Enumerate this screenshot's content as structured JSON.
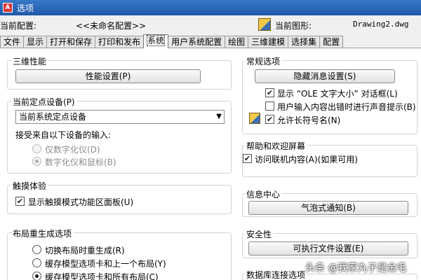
{
  "window": {
    "title": "选项",
    "icon": "app-icon"
  },
  "header": {
    "config_label": "当前配置:",
    "config_value": "<<未命名配置>>",
    "drawing_label": "当前图形:",
    "drawing_value": "Drawing2.dwg"
  },
  "tabs": [
    {
      "label": "文件"
    },
    {
      "label": "显示"
    },
    {
      "label": "打开和保存"
    },
    {
      "label": "打印和发布"
    },
    {
      "label": "系统",
      "active": true
    },
    {
      "label": "用户系统配置"
    },
    {
      "label": "绘图"
    },
    {
      "label": "三维建模"
    },
    {
      "label": "选择集"
    },
    {
      "label": "配置"
    }
  ],
  "left": {
    "perf": {
      "title": "三维性能",
      "button": "性能设置(P)"
    },
    "pointing": {
      "title": "当前定点设备(P)",
      "select_value": "当前系统定点设备",
      "accept_label": "接受来自以下设备的输入:",
      "opt1": "仅数字化仪(D)",
      "opt2": "数字化仪和鼠标(B)"
    },
    "touch": {
      "title": "触摸体验",
      "check": "显示触摸模式功能区面板(U)"
    },
    "layout": {
      "title": "布局重生成选项",
      "opt1": "切换布局时重生成(R)",
      "opt2": "缓存模型选项卡和上一个布局(Y)",
      "opt3": "缓存模型选项卡和所有布局(C)"
    }
  },
  "right": {
    "general": {
      "title": "常规选项",
      "button": "隐藏消息设置(S)",
      "check1": "显示 “OLE 文字大小” 对话框(L)",
      "check2": "用户输入内容出错时进行声音提示(B)",
      "check3": "允许长符号名(N)"
    },
    "help": {
      "title": "帮助和欢迎屏幕",
      "check": "访问联机内容(A)(如果可用)"
    },
    "info": {
      "title": "信息中心",
      "button": "气泡式通知(B)"
    },
    "security": {
      "title": "安全性",
      "button": "可执行文件设置(E)"
    },
    "db": {
      "title": "数据库连接选项"
    }
  },
  "watermark": "头条 @我家丸子是金毛"
}
